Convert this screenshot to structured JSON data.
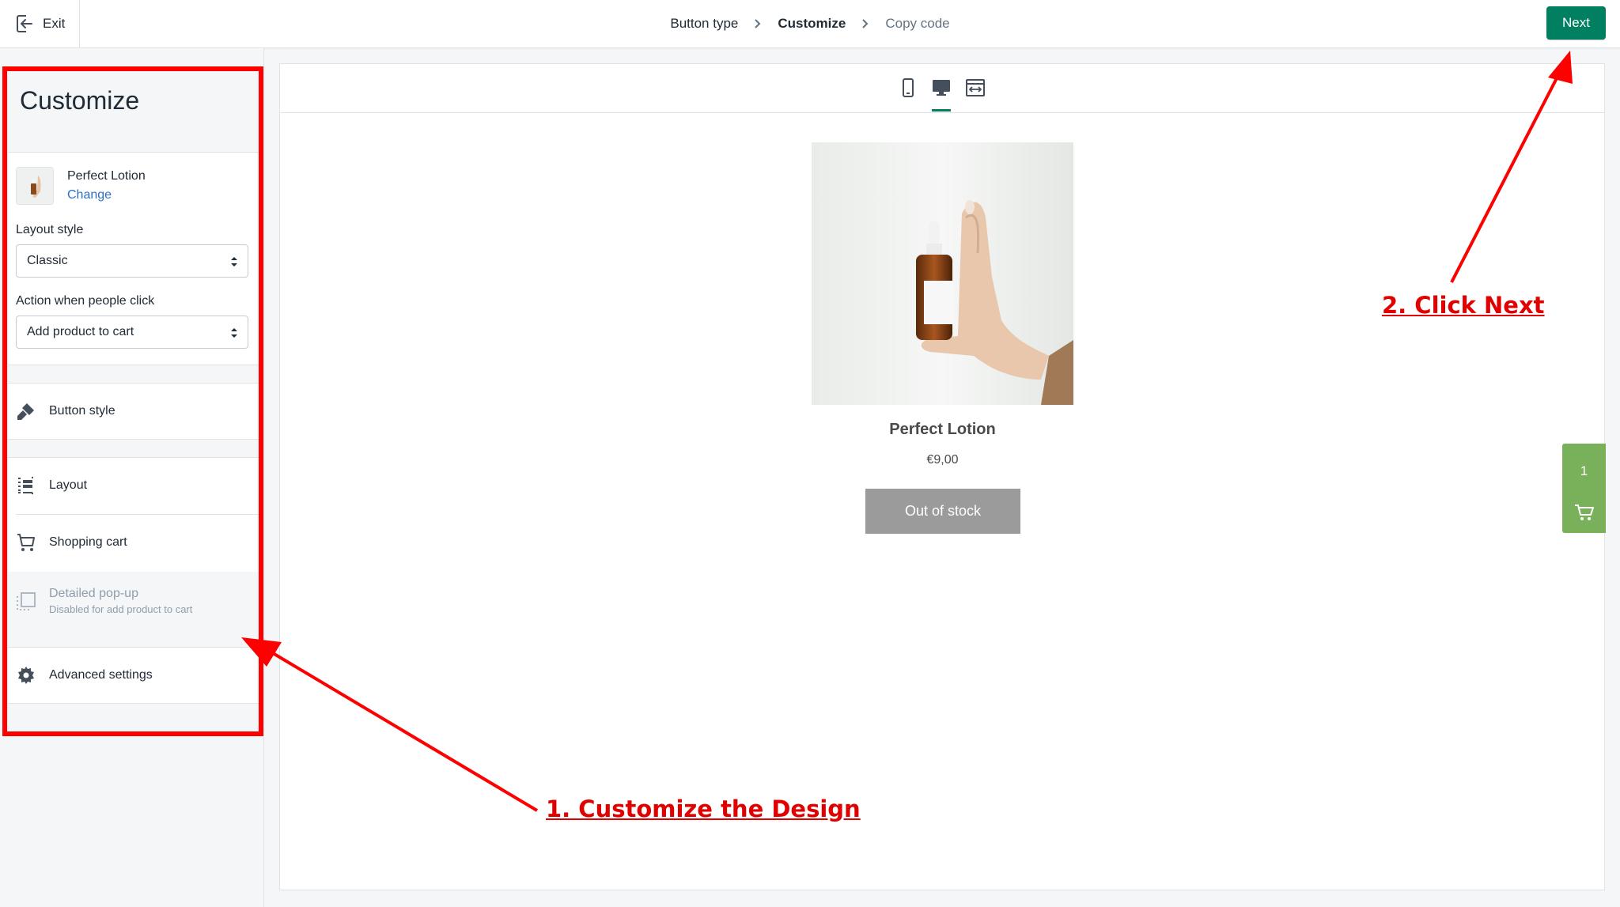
{
  "topbar": {
    "exit_label": "Exit",
    "steps": [
      "Button type",
      "Customize",
      "Copy code"
    ],
    "next_label": "Next"
  },
  "sidebar": {
    "title": "Customize",
    "product": {
      "name": "Perfect Lotion",
      "change_label": "Change"
    },
    "layout_style": {
      "label": "Layout style",
      "value": "Classic"
    },
    "action": {
      "label": "Action when people click",
      "value": "Add product to cart"
    },
    "items": {
      "button_style": "Button style",
      "layout": "Layout",
      "shopping_cart": "Shopping cart",
      "detailed_popup": "Detailed pop-up",
      "detailed_popup_note": "Disabled for add product to cart",
      "advanced_settings": "Advanced settings"
    }
  },
  "preview": {
    "product_title": "Perfect Lotion",
    "price": "€9,00",
    "button_label": "Out of stock",
    "cart_count": "1"
  },
  "annotations": {
    "step1": "1. Customize the Design",
    "step2": "2. Click Next"
  },
  "colors": {
    "primary": "#008060",
    "annotation": "#ff0000",
    "cart_tab": "#78b159",
    "out_of_stock": "#9b9b9b",
    "link": "#2c6ecb"
  }
}
